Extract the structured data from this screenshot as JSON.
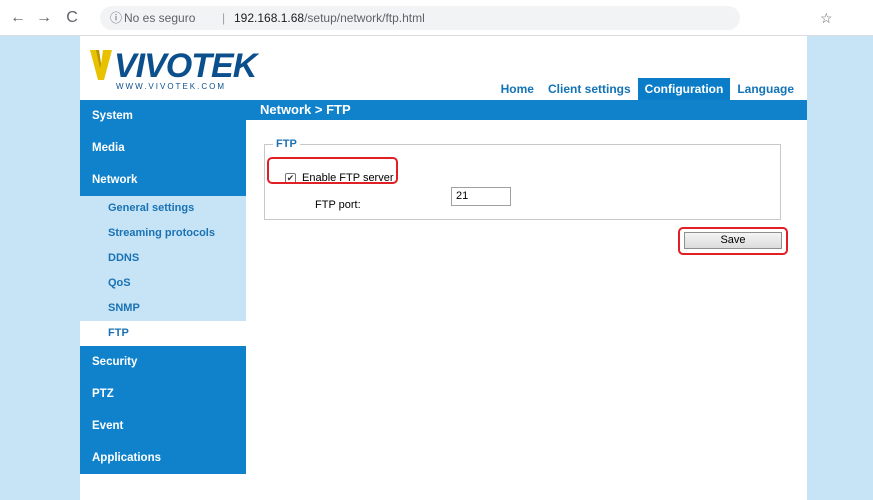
{
  "browser": {
    "back_icon": "arrow-left-icon",
    "forward_icon": "arrow-right-icon",
    "reload_icon": "reload-icon",
    "info_icon": "info-circle-icon",
    "security_text": "No es seguro",
    "separator": "|",
    "url_host": "192.168.1.68",
    "url_path": "/setup/network/ftp.html",
    "star_icon": "star-outline-icon"
  },
  "header": {
    "logo_text": "VIVOTEK",
    "logo_sub": "WWW.VIVOTEK.COM",
    "brand_color": "#0b4f8c",
    "nav": [
      {
        "label": "Home",
        "active": false
      },
      {
        "label": "Client settings",
        "active": false
      },
      {
        "label": "Configuration",
        "active": true
      },
      {
        "label": "Language",
        "active": false
      }
    ]
  },
  "section_title": "Network  > FTP",
  "sidebar": {
    "groups_before": [
      "System",
      "Media",
      "Network"
    ],
    "network_items": [
      {
        "label": "General settings",
        "active": false
      },
      {
        "label": "Streaming protocols",
        "active": false
      },
      {
        "label": "DDNS",
        "active": false
      },
      {
        "label": "QoS",
        "active": false
      },
      {
        "label": "SNMP",
        "active": false
      },
      {
        "label": "FTP",
        "active": true
      }
    ],
    "groups_after": [
      "Security",
      "PTZ",
      "Event",
      "Applications"
    ]
  },
  "ftp_form": {
    "legend": "FTP",
    "enable_label": "Enable FTP server",
    "enable_checked": true,
    "port_label": "FTP port:",
    "port_value": "21"
  },
  "save_label": "Save",
  "colors": {
    "accent": "#0f82cb",
    "sidebar_sub_bg": "#c6e4f6",
    "highlight": "#e01f26"
  }
}
